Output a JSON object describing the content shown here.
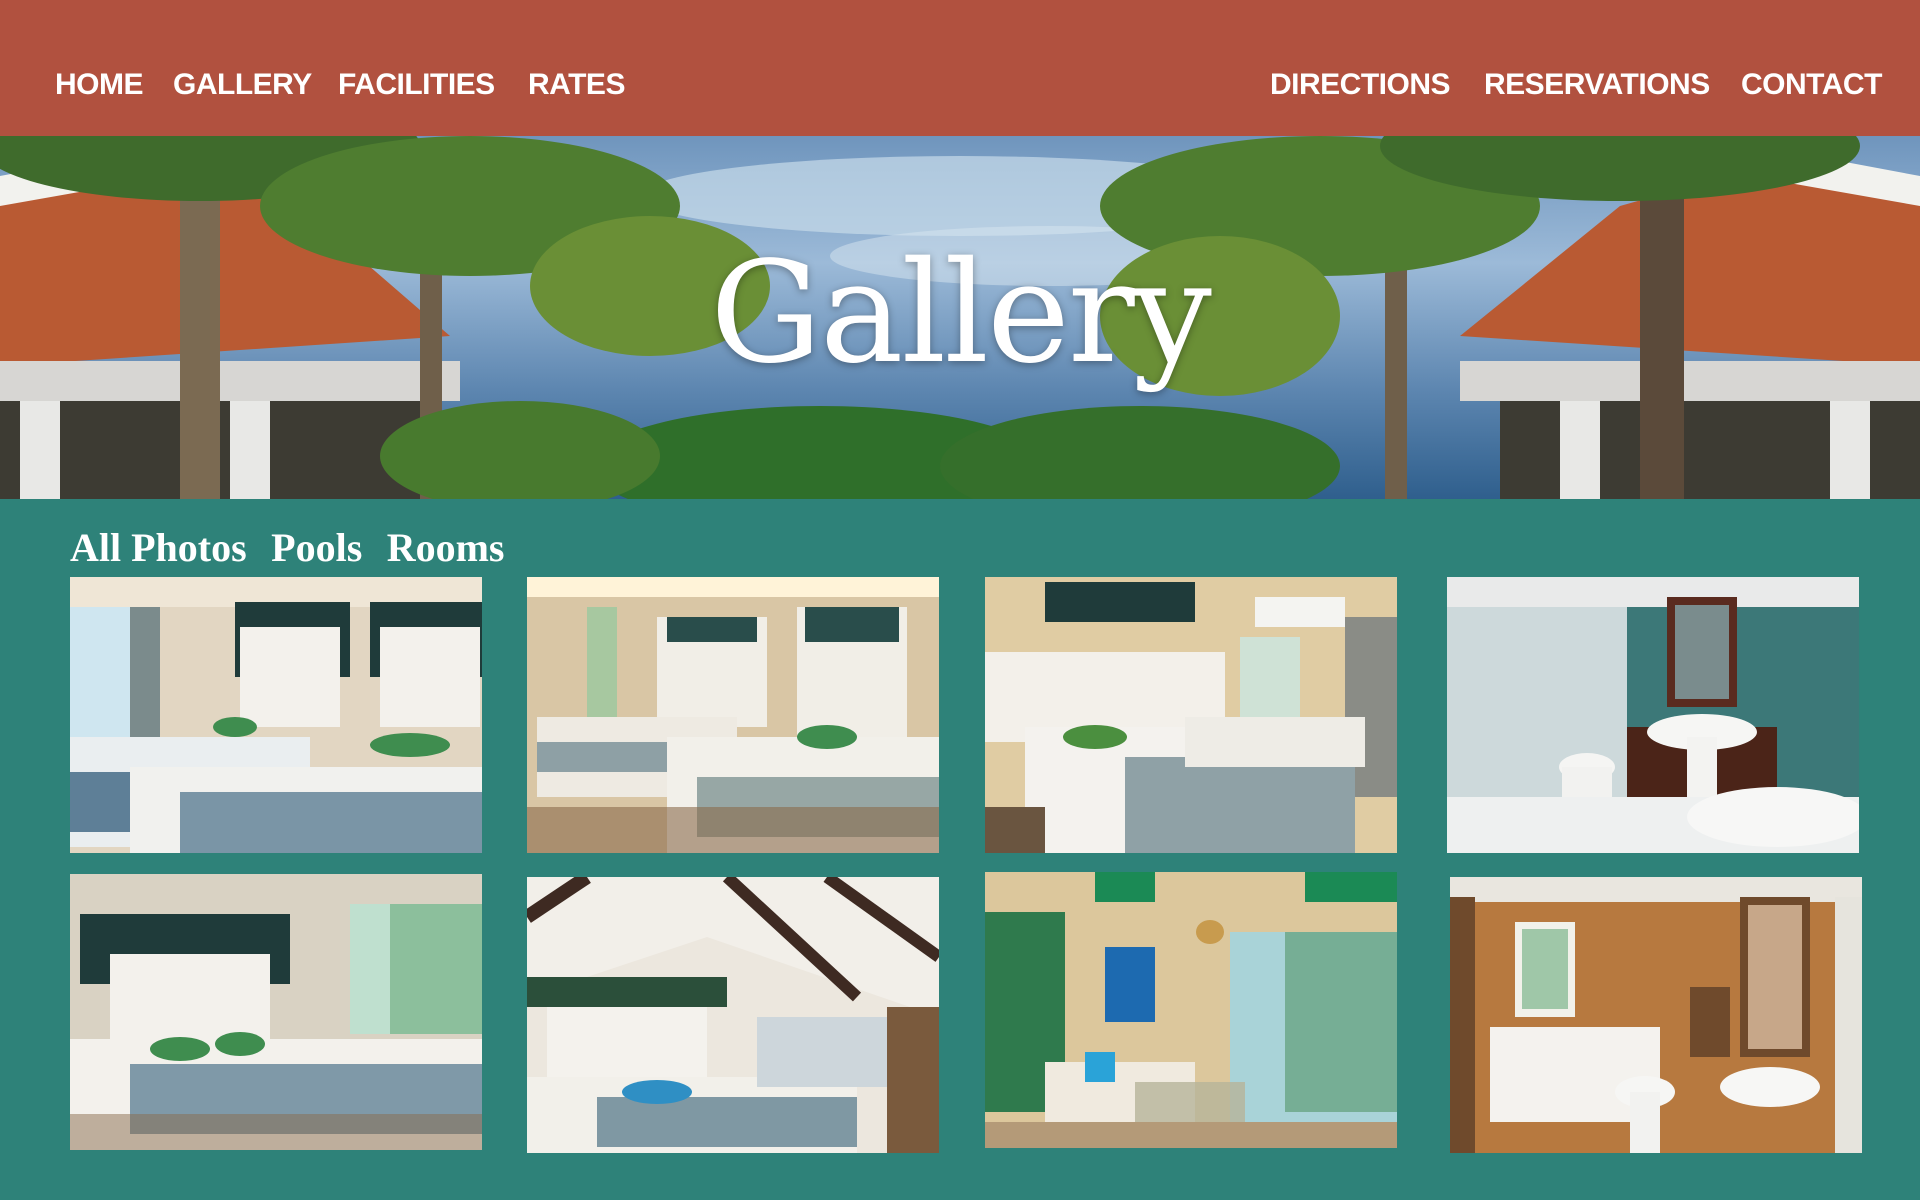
{
  "nav": {
    "left": [
      {
        "label": "HOME"
      },
      {
        "label": "GALLERY"
      },
      {
        "label": "FACILITIES"
      },
      {
        "label": "RATES"
      }
    ],
    "right": [
      {
        "label": "DIRECTIONS"
      },
      {
        "label": "RESERVATIONS"
      },
      {
        "label": "CONTACT"
      }
    ]
  },
  "hero": {
    "title": "Gallery"
  },
  "filters": [
    {
      "label": "All Photos"
    },
    {
      "label": "Pools"
    },
    {
      "label": "Rooms"
    }
  ],
  "colors": {
    "nav_bg": "#b1513f",
    "page_bg": "#2e8279",
    "text": "#ffffff"
  }
}
